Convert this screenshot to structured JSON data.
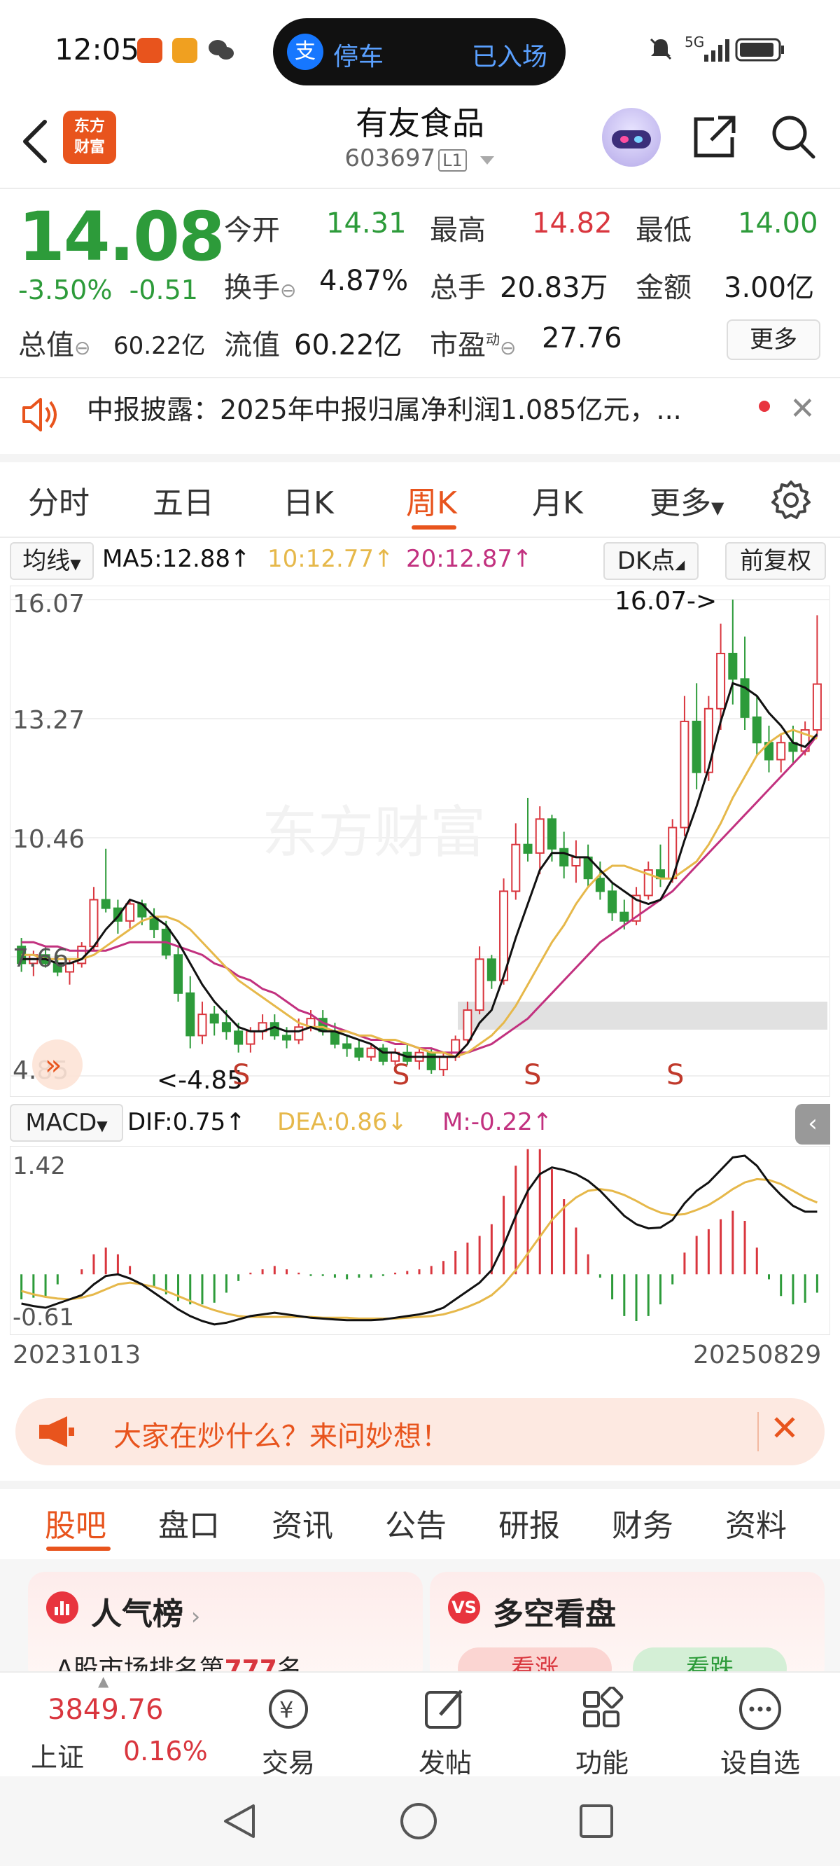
{
  "status": {
    "time": "12:05",
    "pill_left": "停车",
    "pill_right": "已入场",
    "pay_glyph": "支",
    "network": "5G"
  },
  "header": {
    "brand": "东方\n财富",
    "name": "有友食品",
    "code": "603697",
    "level": "L1"
  },
  "quote": {
    "price": "14.08",
    "pct": "-3.50%",
    "chg": "-0.51",
    "open_label": "今开",
    "open": "14.31",
    "high_label": "最高",
    "high": "14.82",
    "low_label": "最低",
    "low": "14.00",
    "turnover_label": "换手",
    "turnover": "4.87%",
    "volume_label": "总手",
    "volume": "20.83万",
    "amount_label": "金额",
    "amount": "3.00亿",
    "mcap_label": "总值",
    "mcap": "60.22亿",
    "float_label": "流值",
    "float_cap": "60.22亿",
    "pe_label": "市盈",
    "pe_sup": "动",
    "pe": "27.76",
    "more": "更多"
  },
  "news": {
    "text": "中报披露：2025年中报归属净利润1.085亿元，..."
  },
  "period_tabs": [
    "分时",
    "五日",
    "日K",
    "周K",
    "月K",
    "更多"
  ],
  "period_active": "周K",
  "ma": {
    "selector": "均线",
    "ma5": "MA5:12.88↑",
    "ma10": "10:12.77↑",
    "ma20": "20:12.87↑",
    "dk": "DK点",
    "adjust": "前复权",
    "colors": {
      "ma5": "#111111",
      "ma10": "#e6b84a",
      "ma20": "#c2317f"
    }
  },
  "chart_data": [
    {
      "type": "candlestick",
      "title": "周K",
      "y_labels": [
        "16.07",
        "13.27",
        "10.46",
        "7.66",
        "4.85"
      ],
      "ylim": [
        4.85,
        16.07
      ],
      "max_annotation": "16.07->",
      "min_annotation": "<-4.85",
      "signals": [
        "S",
        "S",
        "S",
        "S"
      ],
      "watermark": "东方财富",
      "x_start": "20231013",
      "x_end": "20250829",
      "colors": {
        "up": "#d9363e",
        "down": "#2d9b3a"
      },
      "ohlc": [
        [
          7.9,
          8.1,
          7.3,
          7.5
        ],
        [
          7.5,
          7.8,
          7.2,
          7.7
        ],
        [
          7.7,
          7.9,
          7.4,
          7.5
        ],
        [
          7.5,
          7.7,
          7.2,
          7.3
        ],
        [
          7.3,
          7.6,
          7.0,
          7.5
        ],
        [
          7.5,
          8.0,
          7.4,
          7.9
        ],
        [
          7.9,
          9.3,
          7.8,
          9.0
        ],
        [
          9.0,
          10.2,
          8.7,
          8.8
        ],
        [
          8.8,
          9.0,
          8.2,
          8.5
        ],
        [
          8.5,
          9.0,
          8.3,
          8.9
        ],
        [
          8.9,
          9.0,
          8.4,
          8.6
        ],
        [
          8.6,
          8.8,
          8.1,
          8.3
        ],
        [
          8.3,
          8.5,
          7.6,
          7.7
        ],
        [
          7.7,
          7.9,
          6.6,
          6.8
        ],
        [
          6.8,
          7.2,
          5.5,
          5.8
        ],
        [
          5.8,
          6.6,
          5.6,
          6.3
        ],
        [
          6.3,
          6.5,
          5.8,
          6.1
        ],
        [
          6.1,
          6.4,
          5.7,
          5.9
        ],
        [
          5.9,
          6.1,
          5.4,
          5.6
        ],
        [
          5.6,
          6.0,
          5.4,
          5.9
        ],
        [
          5.9,
          6.3,
          5.7,
          6.1
        ],
        [
          6.1,
          6.3,
          5.7,
          5.8
        ],
        [
          5.8,
          6.0,
          5.5,
          5.7
        ],
        [
          5.7,
          6.2,
          5.6,
          6.0
        ],
        [
          6.0,
          6.4,
          5.9,
          6.2
        ],
        [
          6.2,
          6.4,
          5.8,
          5.9
        ],
        [
          5.9,
          6.1,
          5.5,
          5.6
        ],
        [
          5.6,
          5.8,
          5.3,
          5.5
        ],
        [
          5.5,
          5.7,
          5.2,
          5.3
        ],
        [
          5.3,
          5.6,
          5.2,
          5.5
        ],
        [
          5.5,
          5.6,
          5.1,
          5.2
        ],
        [
          5.2,
          5.5,
          5.1,
          5.4
        ],
        [
          5.4,
          5.6,
          5.1,
          5.2
        ],
        [
          5.2,
          5.5,
          5.0,
          5.4
        ],
        [
          5.4,
          5.5,
          4.9,
          5.0
        ],
        [
          5.0,
          5.4,
          4.85,
          5.3
        ],
        [
          5.3,
          5.8,
          5.2,
          5.7
        ],
        [
          5.7,
          6.6,
          5.6,
          6.4
        ],
        [
          6.4,
          7.9,
          6.3,
          7.6
        ],
        [
          7.6,
          7.7,
          6.9,
          7.1
        ],
        [
          7.1,
          9.5,
          7.0,
          9.2
        ],
        [
          9.2,
          10.8,
          9.0,
          10.3
        ],
        [
          10.3,
          11.4,
          9.9,
          10.1
        ],
        [
          10.1,
          11.2,
          9.6,
          10.9
        ],
        [
          10.9,
          11.0,
          9.9,
          10.2
        ],
        [
          10.2,
          10.6,
          9.5,
          9.8
        ],
        [
          9.8,
          10.4,
          9.4,
          10.0
        ],
        [
          10.0,
          10.3,
          9.3,
          9.5
        ],
        [
          9.5,
          9.9,
          9.0,
          9.2
        ],
        [
          9.2,
          9.4,
          8.5,
          8.7
        ],
        [
          8.7,
          9.0,
          8.3,
          8.5
        ],
        [
          8.5,
          9.3,
          8.4,
          9.1
        ],
        [
          9.1,
          9.9,
          9.0,
          9.7
        ],
        [
          9.7,
          10.3,
          9.3,
          9.5
        ],
        [
          9.5,
          10.9,
          9.4,
          10.7
        ],
        [
          10.7,
          13.8,
          10.5,
          13.2
        ],
        [
          13.2,
          14.1,
          11.6,
          12.0
        ],
        [
          12.0,
          13.8,
          11.8,
          13.5
        ],
        [
          13.5,
          15.5,
          13.0,
          14.8
        ],
        [
          14.8,
          16.07,
          13.6,
          14.2
        ],
        [
          14.2,
          15.2,
          13.0,
          13.3
        ],
        [
          13.3,
          13.8,
          12.4,
          12.7
        ],
        [
          12.7,
          13.1,
          12.0,
          12.3
        ],
        [
          12.3,
          12.9,
          12.0,
          12.7
        ],
        [
          12.7,
          13.1,
          12.2,
          12.5
        ],
        [
          12.5,
          13.2,
          12.4,
          13.0
        ],
        [
          13.0,
          15.7,
          12.9,
          14.08
        ]
      ],
      "ma5": [
        7.6,
        7.6,
        7.6,
        7.5,
        7.5,
        7.6,
        7.9,
        8.3,
        8.6,
        9.0,
        8.9,
        8.6,
        8.4,
        8.0,
        7.5,
        7.0,
        6.6,
        6.3,
        6.0,
        5.9,
        5.9,
        6.0,
        5.9,
        5.9,
        6.0,
        5.9,
        5.9,
        5.8,
        5.7,
        5.6,
        5.4,
        5.4,
        5.3,
        5.3,
        5.3,
        5.3,
        5.3,
        5.6,
        6.1,
        6.4,
        7.2,
        8.1,
        8.9,
        9.7,
        10.1,
        10.1,
        10.0,
        10.0,
        9.7,
        9.4,
        9.2,
        9.0,
        8.9,
        9.0,
        9.5,
        10.4,
        11.2,
        12.1,
        13.2,
        14.1,
        14.0,
        13.8,
        13.4,
        13.1,
        12.7,
        12.6,
        12.9
      ],
      "ma10": [
        7.7,
        7.7,
        7.6,
        7.6,
        7.6,
        7.6,
        7.7,
        7.9,
        8.1,
        8.3,
        8.5,
        8.6,
        8.6,
        8.5,
        8.3,
        8.0,
        7.7,
        7.4,
        7.1,
        6.9,
        6.7,
        6.5,
        6.3,
        6.1,
        6.0,
        6.0,
        5.9,
        5.9,
        5.8,
        5.8,
        5.7,
        5.7,
        5.6,
        5.5,
        5.4,
        5.4,
        5.3,
        5.4,
        5.6,
        5.8,
        6.1,
        6.5,
        7.0,
        7.5,
        8.0,
        8.4,
        8.9,
        9.3,
        9.6,
        9.8,
        9.8,
        9.7,
        9.6,
        9.5,
        9.5,
        9.7,
        9.9,
        10.3,
        10.8,
        11.4,
        11.9,
        12.4,
        12.7,
        12.9,
        13.0,
        12.9,
        12.8
      ],
      "ma20": [
        8.0,
        8.0,
        7.9,
        7.9,
        7.8,
        7.8,
        7.8,
        7.8,
        7.9,
        8.0,
        8.0,
        8.0,
        8.0,
        7.9,
        7.8,
        7.7,
        7.5,
        7.4,
        7.2,
        7.1,
        6.9,
        6.8,
        6.6,
        6.4,
        6.3,
        6.1,
        6.0,
        5.9,
        5.8,
        5.7,
        5.7,
        5.6,
        5.6,
        5.5,
        5.5,
        5.4,
        5.4,
        5.4,
        5.5,
        5.6,
        5.8,
        6.0,
        6.2,
        6.5,
        6.8,
        7.1,
        7.4,
        7.7,
        8.0,
        8.2,
        8.4,
        8.6,
        8.8,
        9.0,
        9.2,
        9.5,
        9.8,
        10.1,
        10.4,
        10.7,
        11.0,
        11.3,
        11.6,
        11.9,
        12.2,
        12.5,
        12.87
      ]
    },
    {
      "type": "bar+line",
      "title": "MACD",
      "selector": "MACD",
      "dif_label": "DIF:0.75↑",
      "dea_label": "DEA:0.86↓",
      "m_label": "M:-0.22↑",
      "y_labels": [
        "1.42",
        "-0.61"
      ],
      "ylim": [
        -0.61,
        1.42
      ],
      "dif": [
        -0.35,
        -0.38,
        -0.4,
        -0.35,
        -0.3,
        -0.25,
        -0.12,
        -0.02,
        0.0,
        -0.05,
        -0.12,
        -0.22,
        -0.32,
        -0.42,
        -0.5,
        -0.56,
        -0.6,
        -0.58,
        -0.54,
        -0.5,
        -0.48,
        -0.46,
        -0.48,
        -0.5,
        -0.52,
        -0.53,
        -0.54,
        -0.55,
        -0.55,
        -0.55,
        -0.54,
        -0.52,
        -0.5,
        -0.48,
        -0.45,
        -0.4,
        -0.3,
        -0.2,
        -0.1,
        0.05,
        0.35,
        0.7,
        1.0,
        1.2,
        1.28,
        1.25,
        1.2,
        1.12,
        1.0,
        0.85,
        0.7,
        0.6,
        0.55,
        0.56,
        0.65,
        0.85,
        1.0,
        1.1,
        1.25,
        1.4,
        1.42,
        1.3,
        1.1,
        0.95,
        0.82,
        0.75,
        0.75
      ],
      "dea": [
        -0.2,
        -0.24,
        -0.27,
        -0.29,
        -0.3,
        -0.28,
        -0.24,
        -0.18,
        -0.12,
        -0.1,
        -0.12,
        -0.15,
        -0.2,
        -0.26,
        -0.32,
        -0.38,
        -0.43,
        -0.47,
        -0.5,
        -0.51,
        -0.51,
        -0.51,
        -0.51,
        -0.51,
        -0.51,
        -0.52,
        -0.52,
        -0.52,
        -0.53,
        -0.53,
        -0.53,
        -0.53,
        -0.52,
        -0.51,
        -0.5,
        -0.48,
        -0.44,
        -0.39,
        -0.33,
        -0.25,
        -0.12,
        0.05,
        0.25,
        0.45,
        0.65,
        0.8,
        0.92,
        1.0,
        1.02,
        1.0,
        0.95,
        0.88,
        0.8,
        0.74,
        0.71,
        0.72,
        0.77,
        0.83,
        0.92,
        1.02,
        1.1,
        1.14,
        1.13,
        1.08,
        1.0,
        0.92,
        0.86
      ],
      "colors": {
        "dif": "#111111",
        "dea": "#e6b84a",
        "up": "#d9363e",
        "down": "#2d9b3a"
      }
    }
  ],
  "ask_banner": {
    "text": "大家在炒什么？来问妙想！"
  },
  "bottom_tabs": [
    "股吧",
    "盘口",
    "资讯",
    "公告",
    "研报",
    "财务",
    "资料"
  ],
  "bottom_active": "股吧",
  "cards": {
    "popularity_title": "人气榜",
    "popularity_sub": "A股市场排名第",
    "popularity_rank": "777",
    "popularity_unit": "名",
    "sentiment_title": "多空看盘",
    "sentiment_icon": "VS",
    "bull": "看涨",
    "bear": "看跌"
  },
  "bottom_bar": {
    "index_value": "3849.76",
    "index_name": "上证",
    "index_pct": "0.16%",
    "trade": "交易",
    "post": "发帖",
    "functions": "功能",
    "watchlist": "设自选"
  }
}
